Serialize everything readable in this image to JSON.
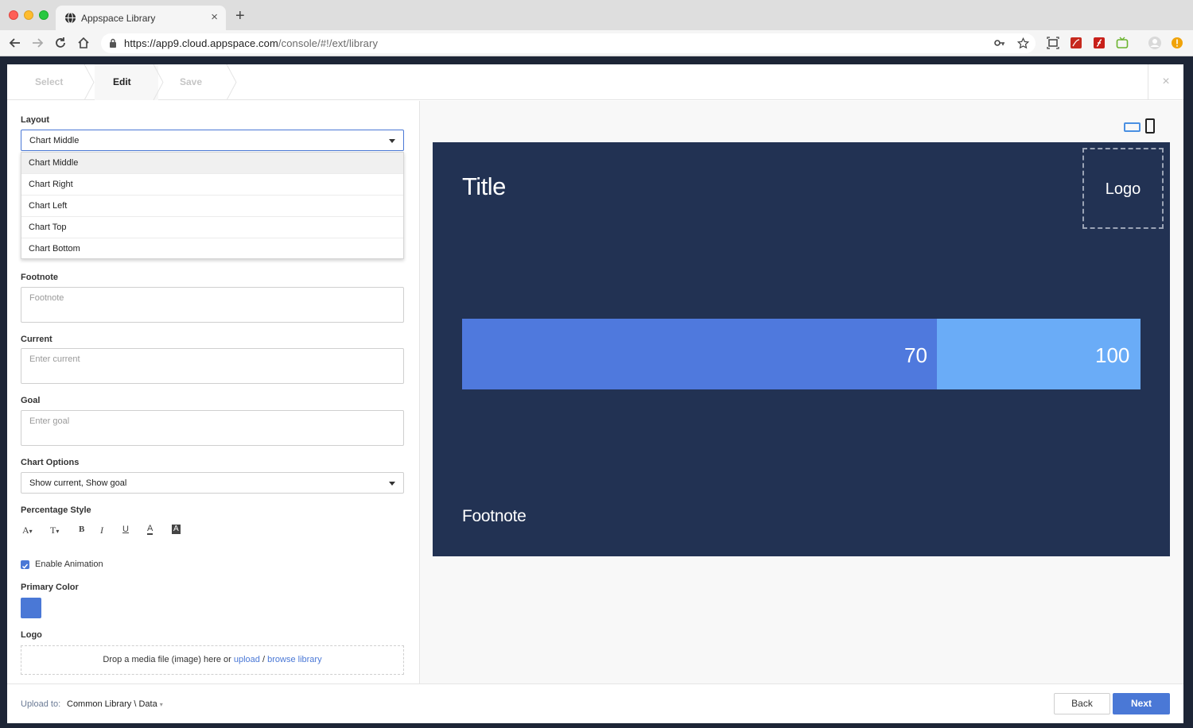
{
  "browser": {
    "tab_title": "Appspace Library",
    "tab_close": "×",
    "new_tab": "+",
    "url_host": "https://app9.cloud.appspace.com",
    "url_path": "/console/#!/ext/library"
  },
  "wizard": {
    "steps": [
      "Select",
      "Edit",
      "Save"
    ],
    "active_step": "Edit",
    "close": "×"
  },
  "form": {
    "layout_label": "Layout",
    "layout_value": "Chart Middle",
    "layout_options": [
      "Chart Middle",
      "Chart Right",
      "Chart Left",
      "Chart Top",
      "Chart Bottom"
    ],
    "footnote_label": "Footnote",
    "footnote_placeholder": "Footnote",
    "current_label": "Current",
    "current_placeholder": "Enter current",
    "goal_label": "Goal",
    "goal_placeholder": "Enter goal",
    "chart_options_label": "Chart Options",
    "chart_options_value": "Show current, Show goal",
    "percentage_style_label": "Percentage Style",
    "format_buttons": {
      "font": "A",
      "size": "T",
      "bold": "B",
      "italic": "I",
      "underline": "U",
      "color": "A",
      "bg": "A"
    },
    "enable_animation_label": "Enable Animation",
    "enable_animation_checked": true,
    "primary_color_label": "Primary Color",
    "primary_color": "#4a78d6",
    "logo_label": "Logo",
    "drop_text": "Drop a media file (image) here or",
    "upload_link": "upload",
    "separator": "/",
    "browse_link": "browse library"
  },
  "footer": {
    "upload_to_label": "Upload to:",
    "upload_path": "Common Library \\ Data",
    "back": "Back",
    "next": "Next"
  },
  "preview": {
    "title": "Title",
    "logo": "Logo",
    "footnote": "Footnote",
    "current_display": "70",
    "goal_display": "100",
    "current_value": 70,
    "goal_value": 100,
    "background": "#223253",
    "current_color": "#4f79dd",
    "goal_color": "#6aacf7"
  }
}
